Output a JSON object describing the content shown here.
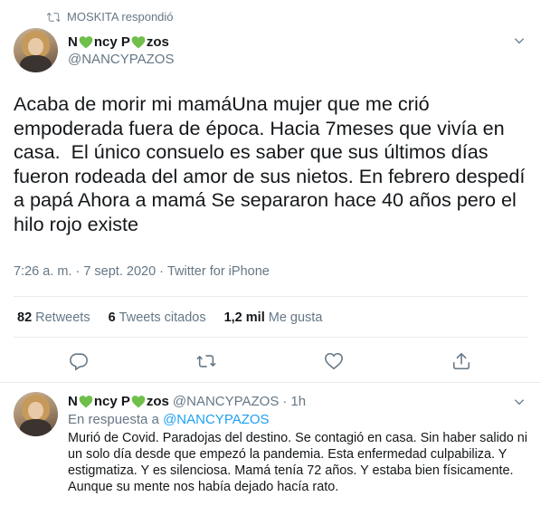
{
  "retweet_context": {
    "text": "MOSKITA respondió"
  },
  "tweet": {
    "author_name_part1": "N",
    "author_name_part2": "ncy P",
    "author_name_part3": "zos",
    "handle": "@NANCYPAZOS",
    "text": "Acaba de morir mi mamáUna mujer que me crió empoderada fuera de época. Hacia 7meses que vivía en casa.  El único consuelo es saber que sus últimos días fueron rodeada del amor de sus nietos. En febrero despedí a papá Ahora a mamá Se separaron hace 40 años pero el hilo rojo existe",
    "time": "7:26 a. m.",
    "date": "7 sept. 2020",
    "separator": "·",
    "source": "Twitter for iPhone",
    "stats": {
      "retweets_count": "82",
      "retweets_label": "Retweets",
      "quotes_count": "6",
      "quotes_label": "Tweets citados",
      "likes_count": "1,2 mil",
      "likes_label": "Me gusta"
    }
  },
  "reply": {
    "author_name_part1": "N",
    "author_name_part2": "ncy P",
    "author_name_part3": "zos",
    "handle": "@NANCYPAZOS",
    "separator": "·",
    "time_ago": "1h",
    "reply_prefix": "En respuesta a",
    "reply_to_handle": "@NANCYPAZOS",
    "text": "Murió de Covid. Paradojas del destino. Se contagió en casa. Sin haber salido ni un solo día desde que empezó la pandemia. Esta enfermedad culpabiliza. Y estigmatiza. Y es silenciosa. Mamá tenía 72 años. Y estaba bien físicamente. Aunque su mente nos había dejado hacía rato."
  },
  "colors": {
    "heart": "#6fbf4a",
    "link": "#1da1f2",
    "secondary_text": "#657786",
    "primary_text": "#14171a",
    "divider": "#e6ecf0"
  },
  "icons": [
    "retweet-icon",
    "heart-emoji-icon",
    "chevron-down-icon",
    "reply-icon",
    "retweet-action-icon",
    "like-icon",
    "share-icon"
  ]
}
